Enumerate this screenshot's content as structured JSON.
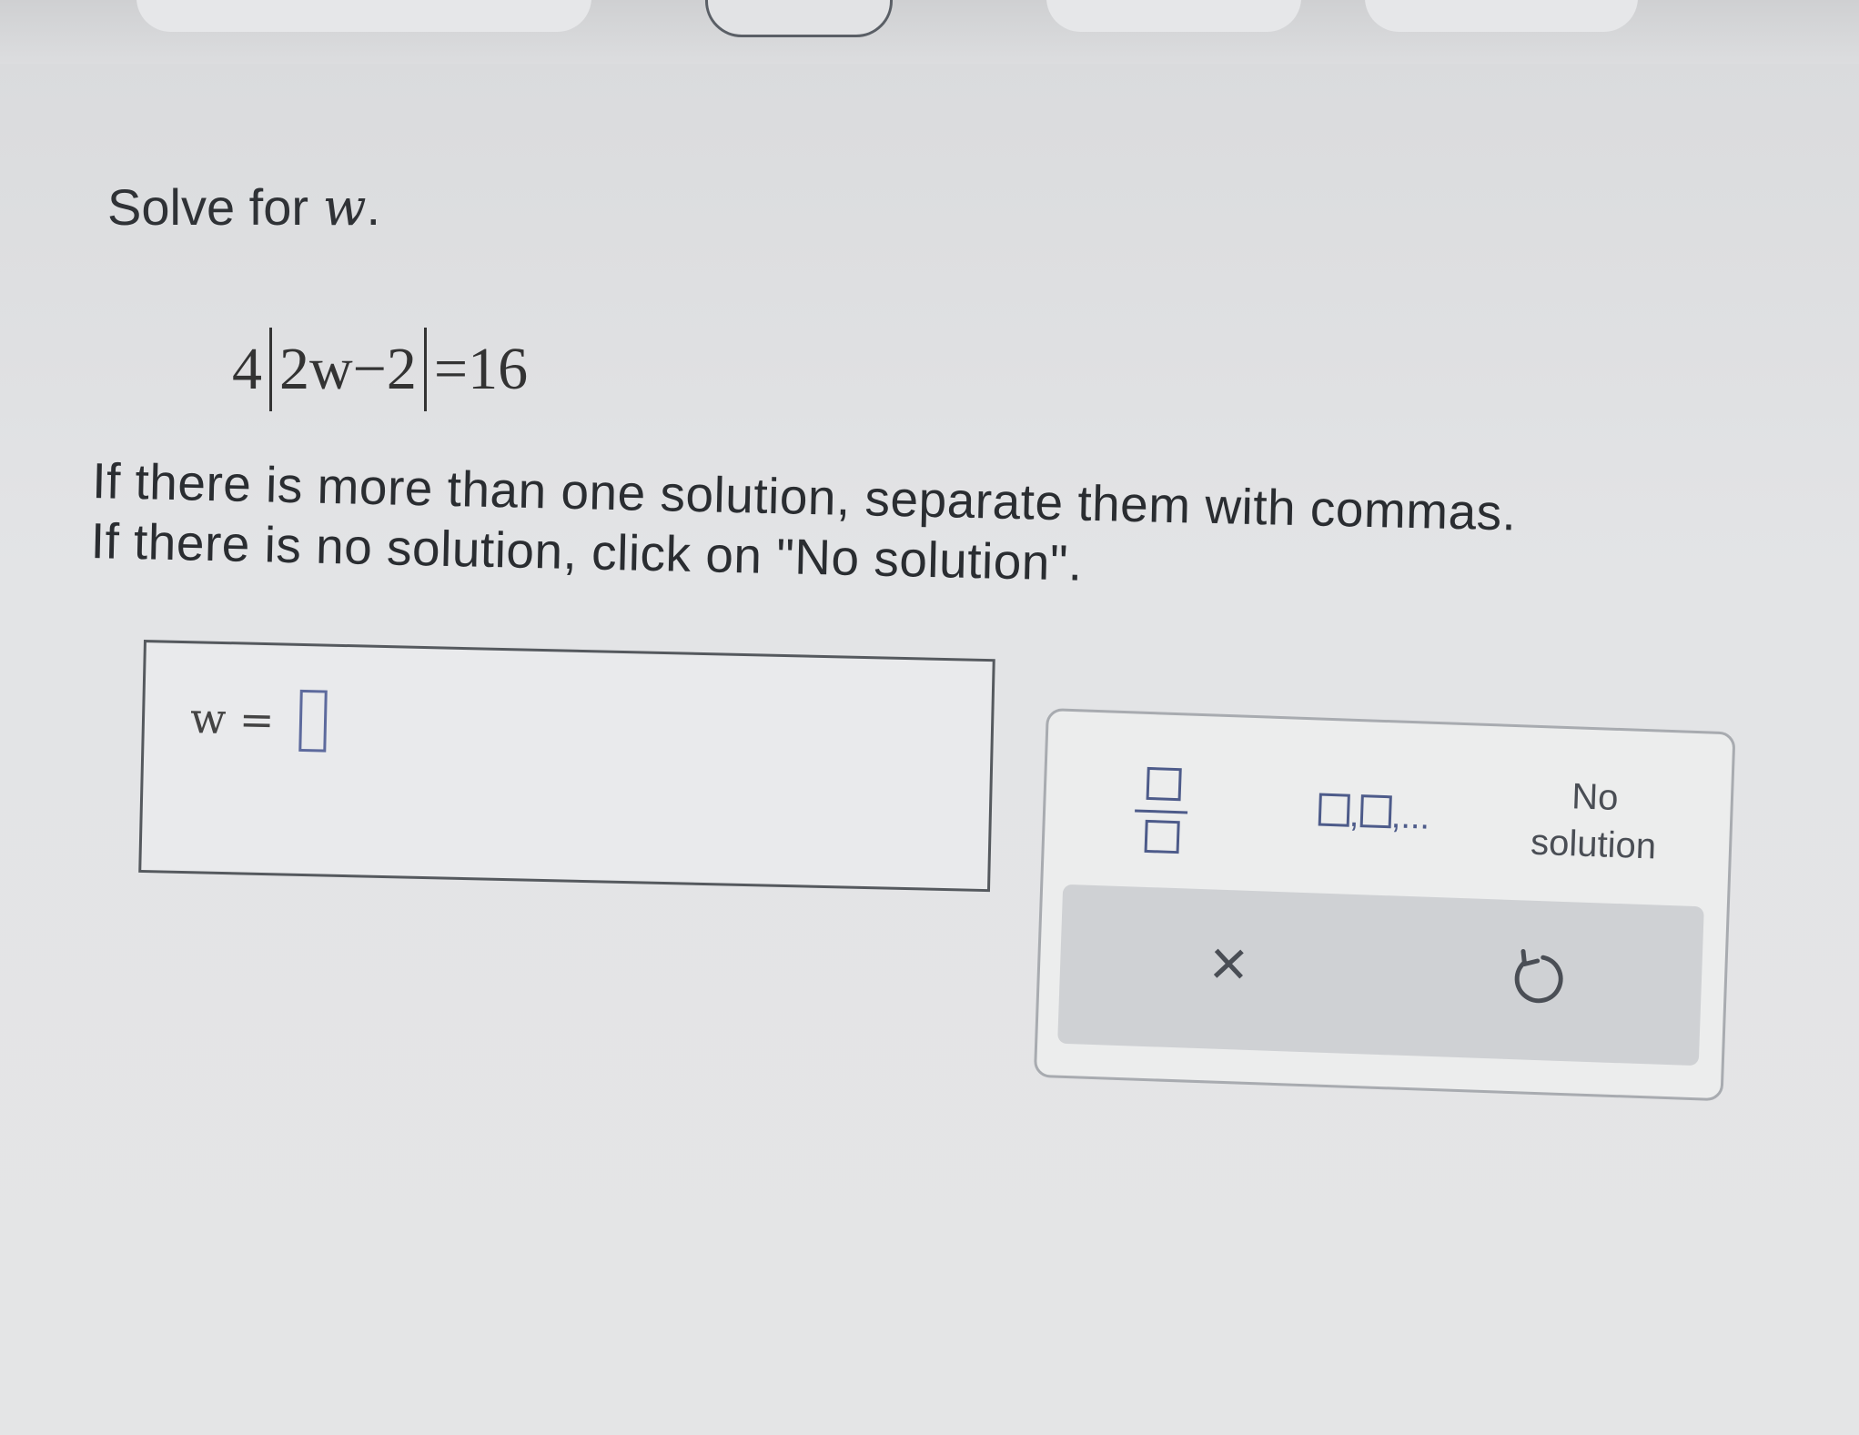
{
  "question": {
    "prompt_text": "Solve for ",
    "variable": "w",
    "period": "."
  },
  "equation": {
    "coefficient": "4",
    "inner": "2w−2",
    "equals": "=",
    "rhs": "16"
  },
  "instructions": {
    "line1": "If there is more than one solution, separate them with commas.",
    "line2": "If there is no solution, click on \"No solution\"."
  },
  "answer": {
    "label": "w =",
    "value": ""
  },
  "keypad": {
    "fraction_key": "fraction-icon",
    "list_key_ellipsis": "...",
    "no_solution_line1": "No",
    "no_solution_line2": "solution",
    "clear_symbol": "×",
    "undo_icon": "undo-icon"
  },
  "colors": {
    "template_box_blue": "#4d5b8a",
    "page_background": "#e3e4e6"
  }
}
